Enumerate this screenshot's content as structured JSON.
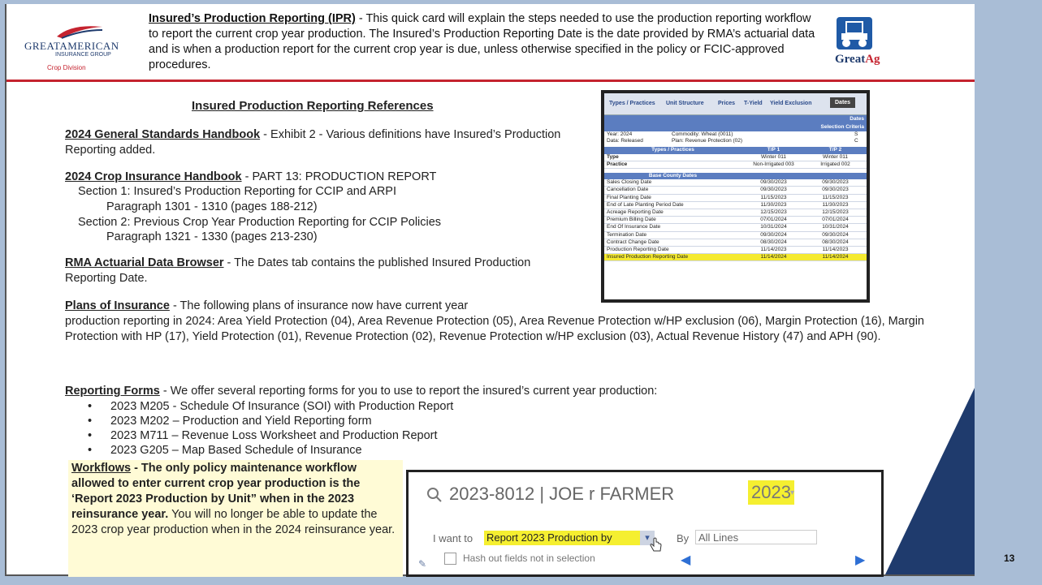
{
  "header": {
    "logo": {
      "main": "GREATAMERICAN",
      "sub": "INSURANCE GROUP",
      "division": "Crop Division"
    },
    "title": "Insured’s Production Reporting (IPR)",
    "description": " - This quick card will explain the steps needed to use the production reporting workflow to report the current crop year production. The Insured’s Production Reporting Date is the date provided by RMA’s actuarial data and is when a production report for the current crop year is due, unless otherwise specified in the policy or FCIC-approved procedures.",
    "greatag": {
      "great": "Great",
      "ag": "Ag"
    }
  },
  "references": {
    "title": "Insured Production Reporting References",
    "gsh_link": "2024 General Standards Handbook",
    "gsh_text": " - Exhibit 2 - Various definitions have Insured’s Production Reporting added.",
    "cih_link": "2024 Crop Insurance Handbook",
    "cih_text": " - PART 13: PRODUCTION REPORT",
    "sec1": "Section 1: Insured’s Production Reporting for CCIP and ARPI",
    "sec1_para": "Paragraph 1301 - 1310 (pages 188-212)",
    "sec2": "Section 2: Previous Crop Year Production Reporting for CCIP Policies",
    "sec2_para": "Paragraph 1321 - 1330 (pages 213-230)",
    "rma_link": "RMA Actuarial Data Browser",
    "rma_text": " - The Dates tab contains the published Insured Production Reporting Date.",
    "plans_link": "Plans of Insurance",
    "plans_text1": " - The following plans of insurance now have current year",
    "plans_text2": "production reporting in 2024: Area Yield Protection (04), Area Revenue Protection (05), Area Revenue Protection w/HP exclusion (06), Margin Protection (16), Margin Protection with HP (17), Yield Protection (01), Revenue Protection (02), Revenue Protection w/HP exclusion (03), Actual Revenue History (47) and APH (90).",
    "forms_link": "Reporting Forms",
    "forms_text": " - We offer several reporting forms for you to use to report the insured’s current year production:",
    "forms": [
      "2023 M205 - Schedule Of Insurance (SOI) with Production Report",
      "2023 M202 – Production and Yield Reporting form",
      "2023 M711 – Revenue Loss Worksheet and Production Report",
      "2023 G205 – Map Based Schedule of Insurance"
    ],
    "bullet": "•"
  },
  "workflow": {
    "link": "Workflows",
    "bold_text": " - The only policy maintenance workflow allowed to enter current crop year production is the ‘Report 2023 Production by Unit” when in the 2023 reinsurance year.",
    "text": " You will no longer be able to update the 2023 crop year production when in the 2024 reinsurance year."
  },
  "dates_table": {
    "tabs": [
      "Types / Practices",
      "Unit Structure",
      "Prices",
      "T-Yield",
      "Yield Exclusion",
      "Dates"
    ],
    "header1": "Dates",
    "header2": "Selection Criteria",
    "year_label": "Year: 2024",
    "commodity": "Commodity: Wheat (0011)",
    "s": "S",
    "data_label": "Data: Released",
    "plan": "Plan:      Revenue Protection (02)",
    "c": "C",
    "types_band": {
      "c1": "Types / Practices",
      "c2": "T/P 1",
      "c3": "T/P 2"
    },
    "type_row": {
      "c1": "Type",
      "c2": "Winter 011",
      "c3": "Winter 011"
    },
    "practice_row": {
      "c1": "Practice",
      "c2": "Non-Irrigated 003",
      "c3": "Irrigated 002"
    },
    "base_band": "Base County Dates",
    "rows": [
      {
        "label": "Sales Closing Date",
        "v1": "09/30/2023",
        "v2": "09/30/2023"
      },
      {
        "label": "Cancellation Date",
        "v1": "09/30/2023",
        "v2": "09/30/2023"
      },
      {
        "label": "Final Planting Date",
        "v1": "11/15/2023",
        "v2": "11/15/2023"
      },
      {
        "label": "End of Late Planting Period Date",
        "v1": "11/30/2023",
        "v2": "11/30/2023"
      },
      {
        "label": "Acreage Reporting Date",
        "v1": "12/15/2023",
        "v2": "12/15/2023"
      },
      {
        "label": "Premium Billing Date",
        "v1": "07/01/2024",
        "v2": "07/01/2024"
      },
      {
        "label": "End Of Insurance Date",
        "v1": "10/31/2024",
        "v2": "10/31/2024"
      },
      {
        "label": "Termination Date",
        "v1": "09/30/2024",
        "v2": "09/30/2024"
      },
      {
        "label": "Contract Change Date",
        "v1": "08/30/2024",
        "v2": "08/30/2024"
      },
      {
        "label": "Production Reporting Date",
        "v1": "11/14/2023",
        "v2": "11/14/2023"
      },
      {
        "label": "Insured Production Reporting Date",
        "v1": "11/14/2024",
        "v2": "11/14/2024"
      }
    ]
  },
  "screenshot": {
    "search": "2023-8012     | JOE r FARMER",
    "year": "2023",
    "iwant": "I want to",
    "action": "Report 2023 Production by",
    "by": "By",
    "lines": "All Lines",
    "hash": "Hash out fields not in selection"
  },
  "page_number": "13"
}
